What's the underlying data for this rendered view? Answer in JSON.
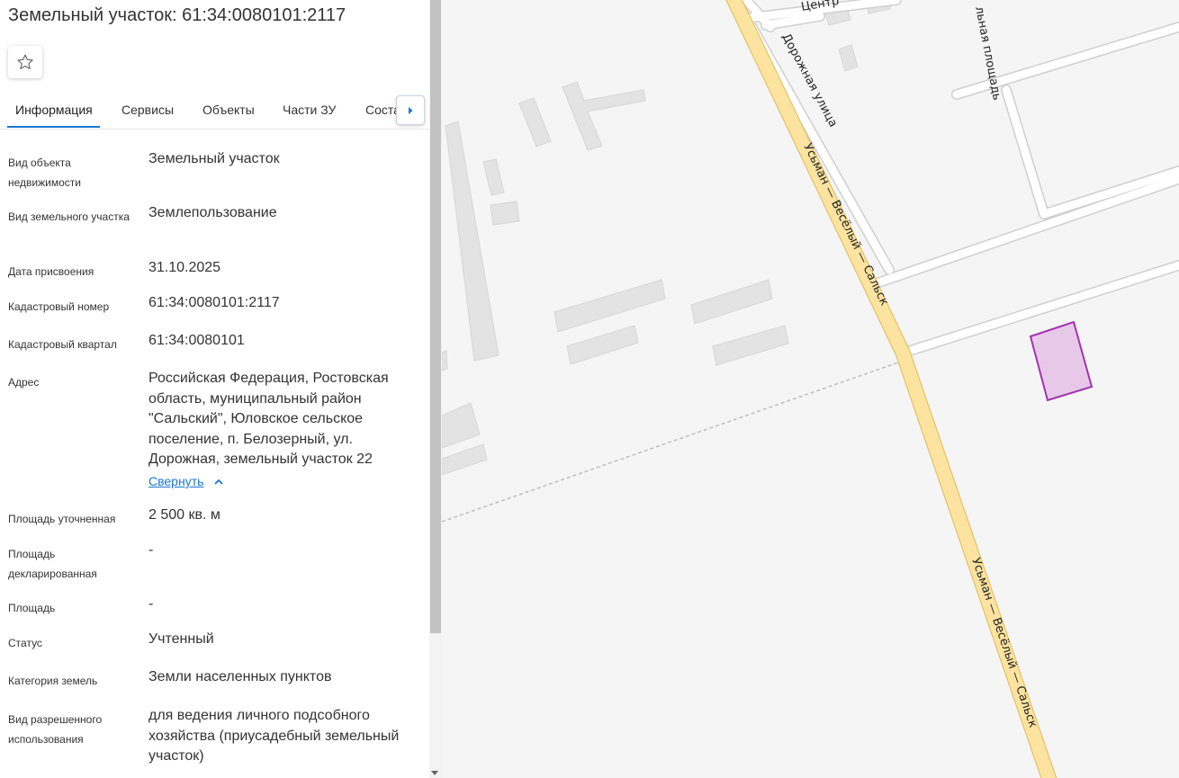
{
  "header": {
    "title": "Земельный участок: 61:34:0080101:2117"
  },
  "icons": {
    "favorite": "star-outline-icon",
    "tab_next": "chevron-right-icon",
    "collapse": "chevron-up-icon"
  },
  "tabs": [
    {
      "label": "Информация"
    },
    {
      "label": "Сервисы"
    },
    {
      "label": "Объекты"
    },
    {
      "label": "Части ЗУ"
    },
    {
      "label": "Соста"
    }
  ],
  "info": {
    "rows": [
      {
        "label": "Вид объекта недвижимости",
        "value": "Земельный участок"
      },
      {
        "label": "Вид земельного участка",
        "value": "Землепользование"
      },
      {
        "label": "Дата присвоения",
        "value": "31.10.2025"
      },
      {
        "label": "Кадастровый номер",
        "value": "61:34:0080101:2117"
      },
      {
        "label": "Кадастровый квартал",
        "value": "61:34:0080101"
      },
      {
        "label": "Адрес",
        "value": "Российская Федерация, Ростовская область, муниципальный район \"Сальский\", Юловское сельское поселение, п. Белозерный, ул. Дорожная, земельный участок 22"
      },
      {
        "label": "Площадь уточненная",
        "value": "2 500 кв. м"
      },
      {
        "label": "Площадь декларированная",
        "value": "-"
      },
      {
        "label": "Площадь",
        "value": "-"
      },
      {
        "label": "Статус",
        "value": "Учтенный"
      },
      {
        "label": "Категория земель",
        "value": "Земли населенных пунктов"
      },
      {
        "label": "Вид разрешенного использования",
        "value": "для ведения личного подсобного хозяйства (приусадебный земельный участок)"
      }
    ],
    "collapse_link": "Свернуть"
  },
  "map": {
    "labels": {
      "road_main_1": "Усьман — Весёлый — Сальск",
      "road_main_2": "Усьман — Весёлый — Сальск",
      "street_dorozhnaya": "Дорожная улица",
      "street_square": "льная площадь",
      "street_centr": "Центр"
    },
    "colors": {
      "background": "#f5f5f5",
      "building": "#e3e3e3",
      "main_road": "#fde3a0",
      "parcel_fill": "#e7c8e8",
      "parcel_stroke": "#a233b0",
      "accent": "#1976d2"
    }
  }
}
